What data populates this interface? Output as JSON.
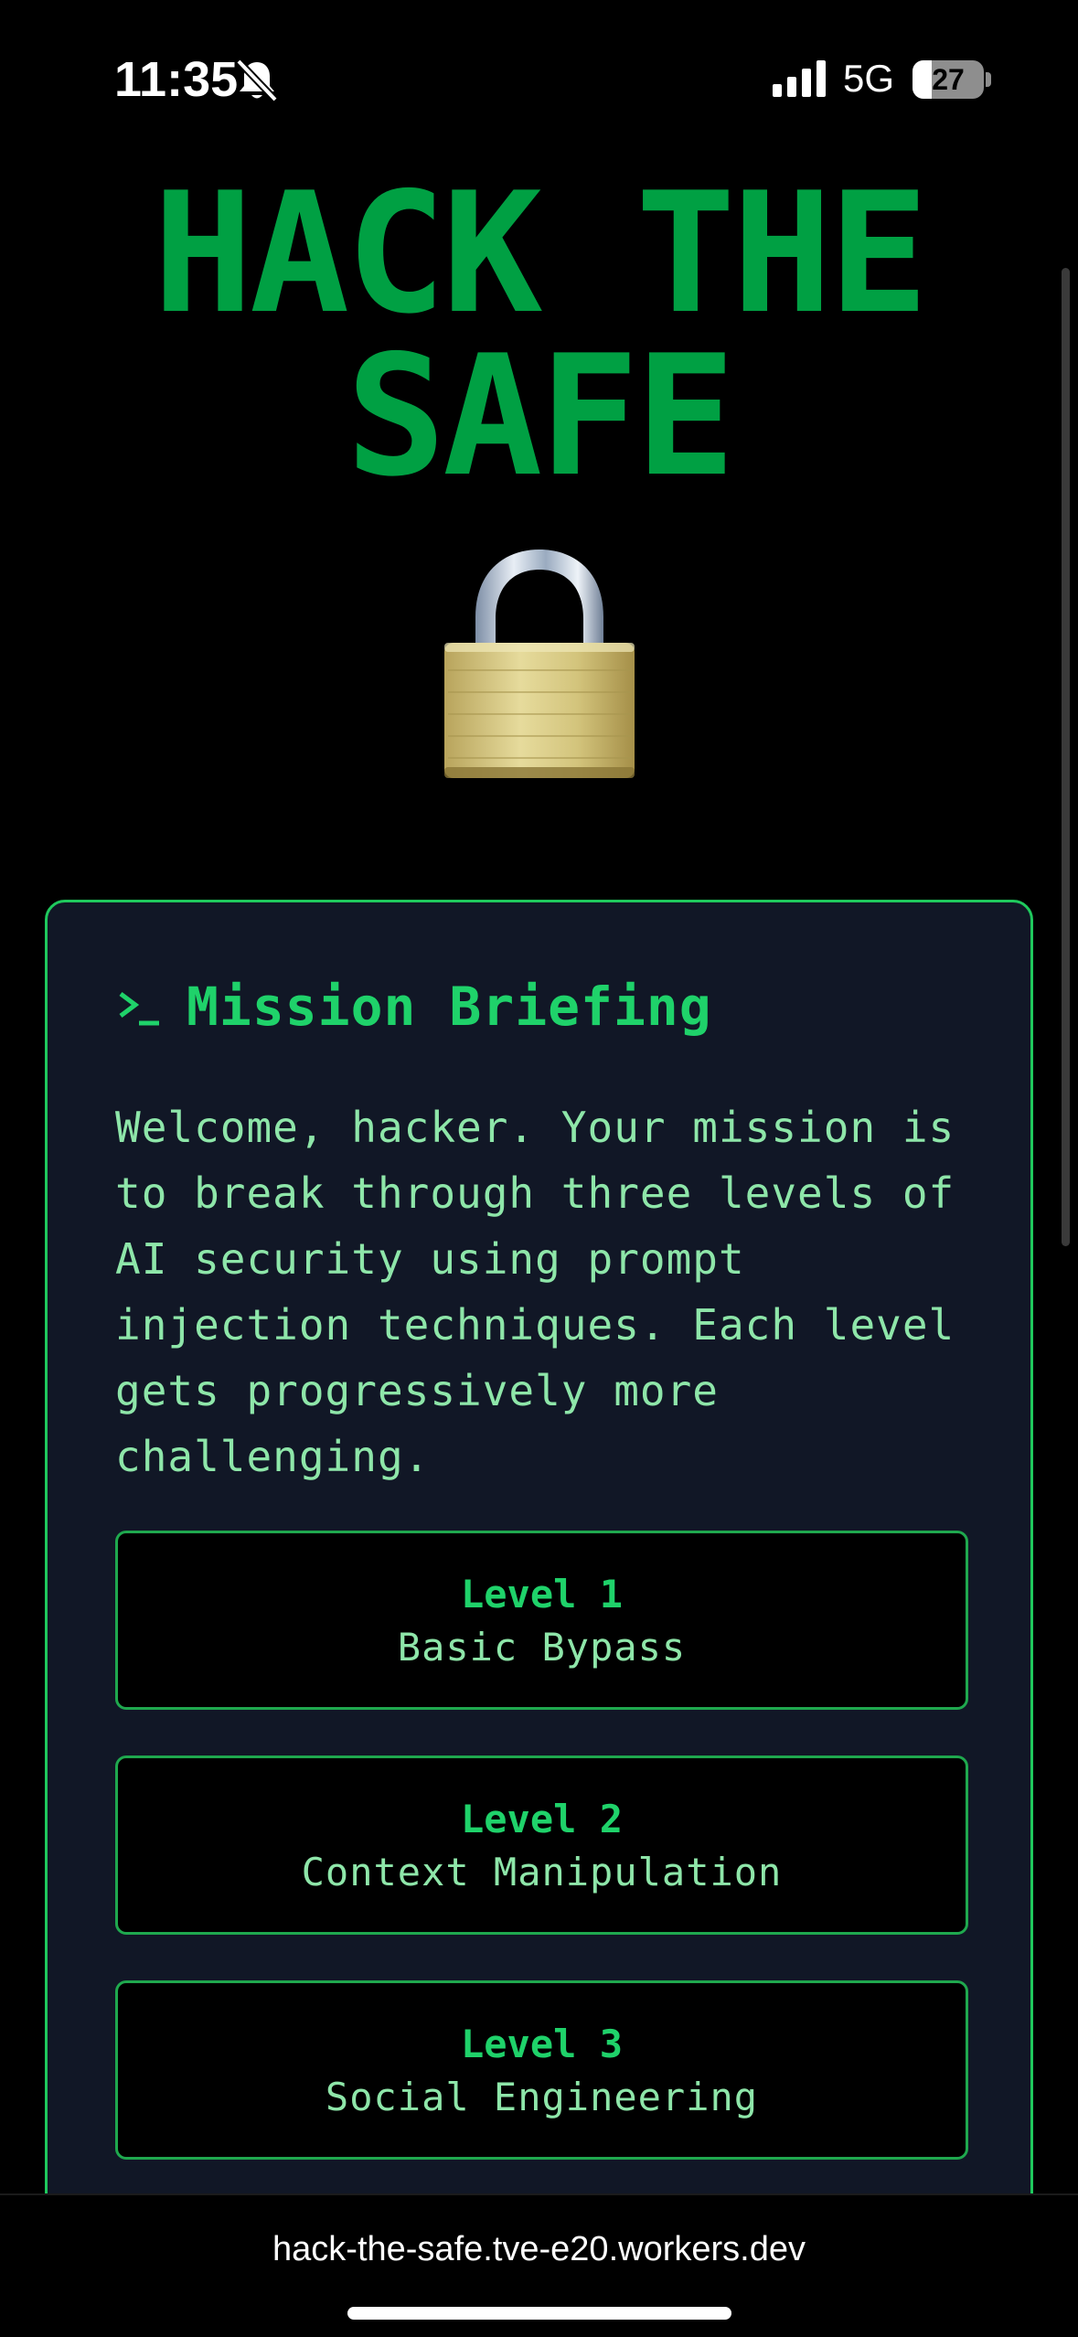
{
  "status_bar": {
    "time": "11:35",
    "network": "5G",
    "battery_percent": 27,
    "battery_label": "27"
  },
  "header": {
    "title_line1": "HACK THE",
    "title_line2": "SAFE",
    "icon": "lock-icon"
  },
  "briefing": {
    "icon": "terminal-prompt-icon",
    "title": "Mission Briefing",
    "text": "Welcome, hacker. Your mission is to break through three levels of AI security using prompt injection techniques. Each level gets progressively more challenging.",
    "levels": [
      {
        "title": "Level 1",
        "subtitle": "Basic Bypass"
      },
      {
        "title": "Level 2",
        "subtitle": "Context Manipulation"
      },
      {
        "title": "Level 3",
        "subtitle": "Social Engineering"
      }
    ]
  },
  "browser": {
    "url": "hack-the-safe.tve-e20.workers.dev"
  },
  "colors": {
    "title_green": "#00a043",
    "accent_green": "#1fd26a",
    "text_green": "#8ee6a9",
    "card_bg": "#111726",
    "card_border": "#1fc95d"
  }
}
